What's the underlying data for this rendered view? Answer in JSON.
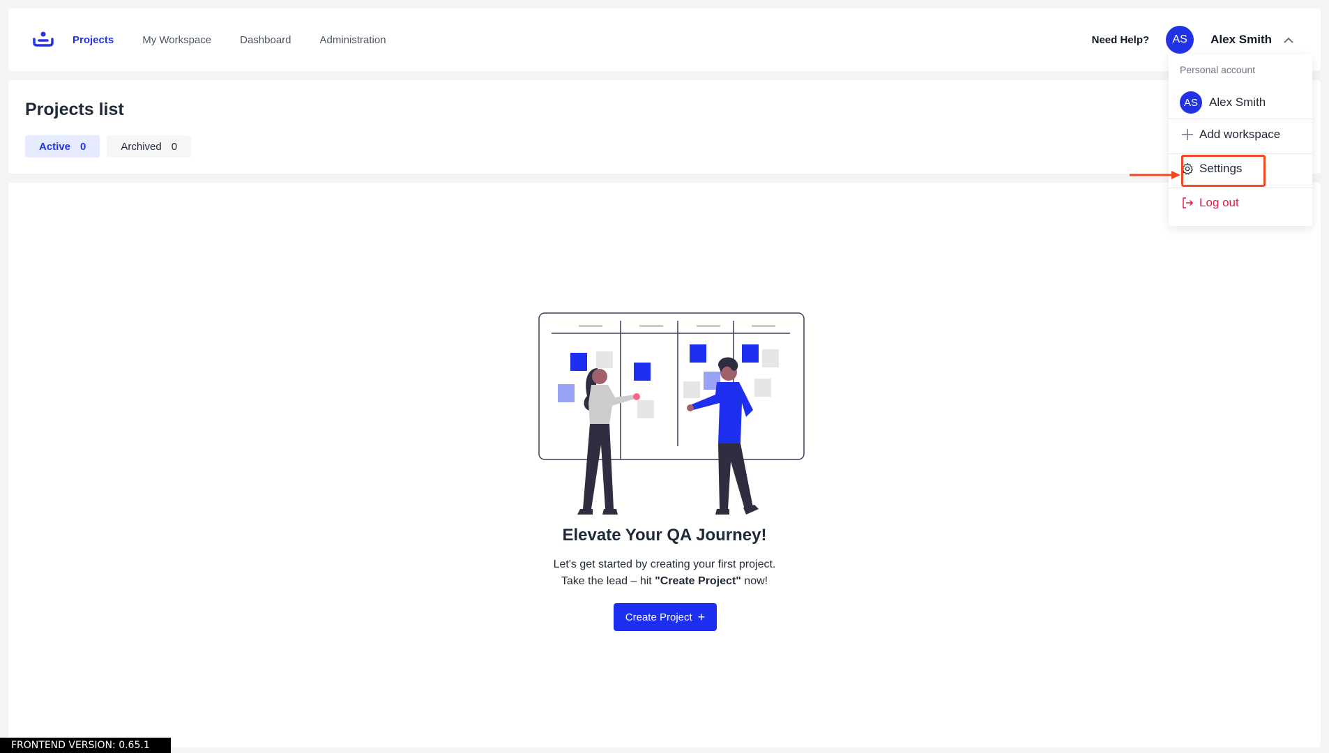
{
  "nav": {
    "items": [
      {
        "label": "Projects",
        "active": true
      },
      {
        "label": "My Workspace",
        "active": false
      },
      {
        "label": "Dashboard",
        "active": false
      },
      {
        "label": "Administration",
        "active": false
      }
    ],
    "need_help": "Need Help?",
    "avatar_initials": "AS",
    "user_name": "Alex Smith"
  },
  "projects": {
    "title": "Projects list",
    "tabs": [
      {
        "label": "Active",
        "count": "0",
        "active": true
      },
      {
        "label": "Archived",
        "count": "0",
        "active": false
      }
    ]
  },
  "empty_state": {
    "title": "Elevate Your QA Journey!",
    "line1": "Let's get started by creating your first project.",
    "line2_prefix": "Take the lead – hit ",
    "line2_bold": "\"Create Project\"",
    "line2_suffix": " now!",
    "button_label": "Create Project"
  },
  "dropdown": {
    "section_label": "Personal account",
    "user_initials": "AS",
    "user_name": "Alex Smith",
    "add_workspace": "Add workspace",
    "settings": "Settings",
    "logout": "Log out"
  },
  "footer": {
    "version": "FRONTEND VERSION: 0.65.1"
  },
  "colors": {
    "brand": "#2233e6",
    "danger": "#e11d48",
    "highlight": "#f04a23"
  }
}
